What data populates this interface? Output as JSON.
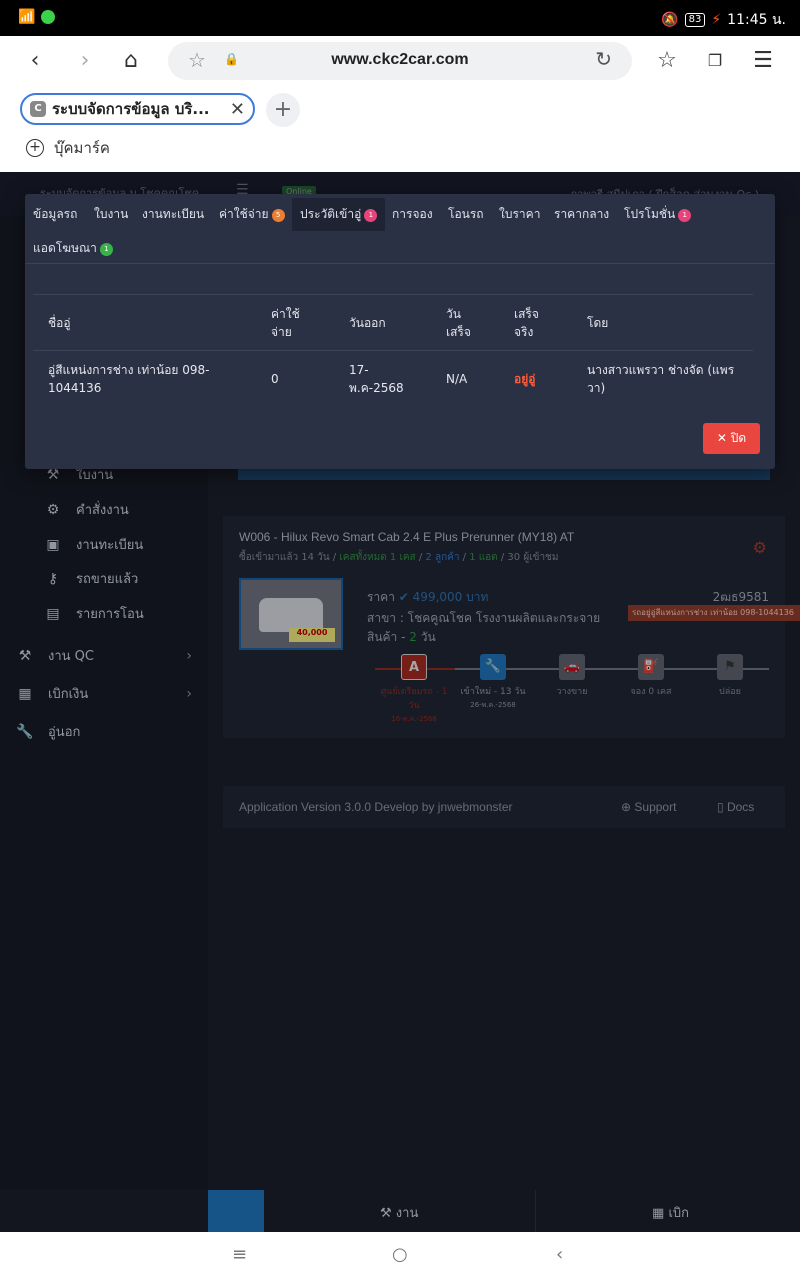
{
  "status": {
    "time": "11:45 น.",
    "battery": "83"
  },
  "browser": {
    "url": "www.ckc2car.com",
    "tab_title": "ระบบจัดการข้อมูล บริ...",
    "tab_favicon": "C",
    "bookmark_label": "บุ๊คมาร์ค"
  },
  "page": {
    "topbar_left": "ระบบจัดการข้อมูล บ.โชคคูณโชค",
    "topbar_badge": "Online",
    "topbar_user": "ภาพจรี สนีปเภา ( ฝึกส็อค ส่วนงาน Qc )",
    "sidebar": {
      "item_a": "ใบงาน",
      "item_b": "คำสั่งงาน",
      "item_c": "งานทะเบียน",
      "item_d": "รถขายแล้ว",
      "item_e": "รายการโอน",
      "qc": "งาน QC",
      "money": "เบิกเงิน",
      "outside": "อู่นอก"
    },
    "card": {
      "title": "W006 - Hilux Revo Smart Cab 2.4 E Plus Prerunner (MY18) AT",
      "sub_a": "ซื้อเข้ามาแล้ว",
      "sub_b": "14",
      "sub_c": "วัน /",
      "sub_d": "เคสทั้งหมด 1 เคส",
      "sub_e": "/",
      "sub_f": "2 ลูกค้า",
      "sub_g": "/",
      "sub_h": "1 แอด",
      "sub_i": "/ 30 ผู้เข้าชม",
      "price_label": "ราคา",
      "price_value": "499,000 บาท",
      "plate": "2ฒธ9581",
      "branch": "สาขา : โชคคูณโชค โรงงานผลิตและกระจาย",
      "stock_label": "สินค้า -",
      "stock_days": "2",
      "stock_unit": "วัน",
      "thumb_tag": "40,000",
      "red_tag": "รถอยู่อู่สีแหน่งการช่าง เท่าน้อย 098-1044136",
      "steps": [
        {
          "icon": "A",
          "label": "ศูนย์เตรียมรถ - 1 วัน",
          "sub": "16-พ.ค.-2568"
        },
        {
          "icon": "🔧",
          "label": "เข้าใหม่ - 13 วัน",
          "sub": "26-พ.ค.-2568"
        },
        {
          "icon": "🚗",
          "label": "วางขาย",
          "sub": ""
        },
        {
          "icon": "⛽",
          "label": "จอง 0 เคส",
          "sub": ""
        },
        {
          "icon": "⚑",
          "label": "ปล่อย",
          "sub": ""
        }
      ]
    },
    "footer": {
      "version": "Application Version 3.0.0 Develop by jnwebmonster",
      "support": "Support",
      "docs": "Docs"
    },
    "bottom": {
      "work": "งาน",
      "withdraw": "เบิก"
    }
  },
  "modal": {
    "tabs": {
      "t1": "ข้อมูลรถ",
      "t2": "ใบงาน",
      "t3": "งานทะเบียน",
      "t4": "ค่าใช้จ่าย",
      "t4_badge": "5",
      "t5": "ประวัติเข้าอู่",
      "t5_badge": "1",
      "t6": "การจอง",
      "t7": "โอนรถ",
      "t8": "ใบราคา",
      "t9": "ราคากลาง",
      "t10": "โปรโมชั่น",
      "t10_badge": "1",
      "t11": "แอดโฆษณา",
      "t11_badge": "1"
    },
    "table": {
      "headers": {
        "h1": "ชื่ออู่",
        "h2a": "ค่าใช้",
        "h2b": "จ่าย",
        "h3": "วันออก",
        "h4a": "วัน",
        "h4b": "เสร็จ",
        "h5a": "เสร็จ",
        "h5b": "จริง",
        "h6": "โดย"
      },
      "row": {
        "name_a": "อู่สีแหน่งการช่าง เท่าน้อย 098-",
        "name_b": "1044136",
        "cost": "0",
        "out_a": "17-",
        "out_b": "พ.ค-2568",
        "done": "N/A",
        "status": "อยู่อู่",
        "by_a": "นางสาวแพรวา ช่างจัด (แพร",
        "by_b": "วา)"
      }
    },
    "close_label": "ปิด"
  },
  "colors": {
    "accent": "#1e6fb5",
    "danger": "#e8463e",
    "modal_bg": "#2a3144"
  }
}
